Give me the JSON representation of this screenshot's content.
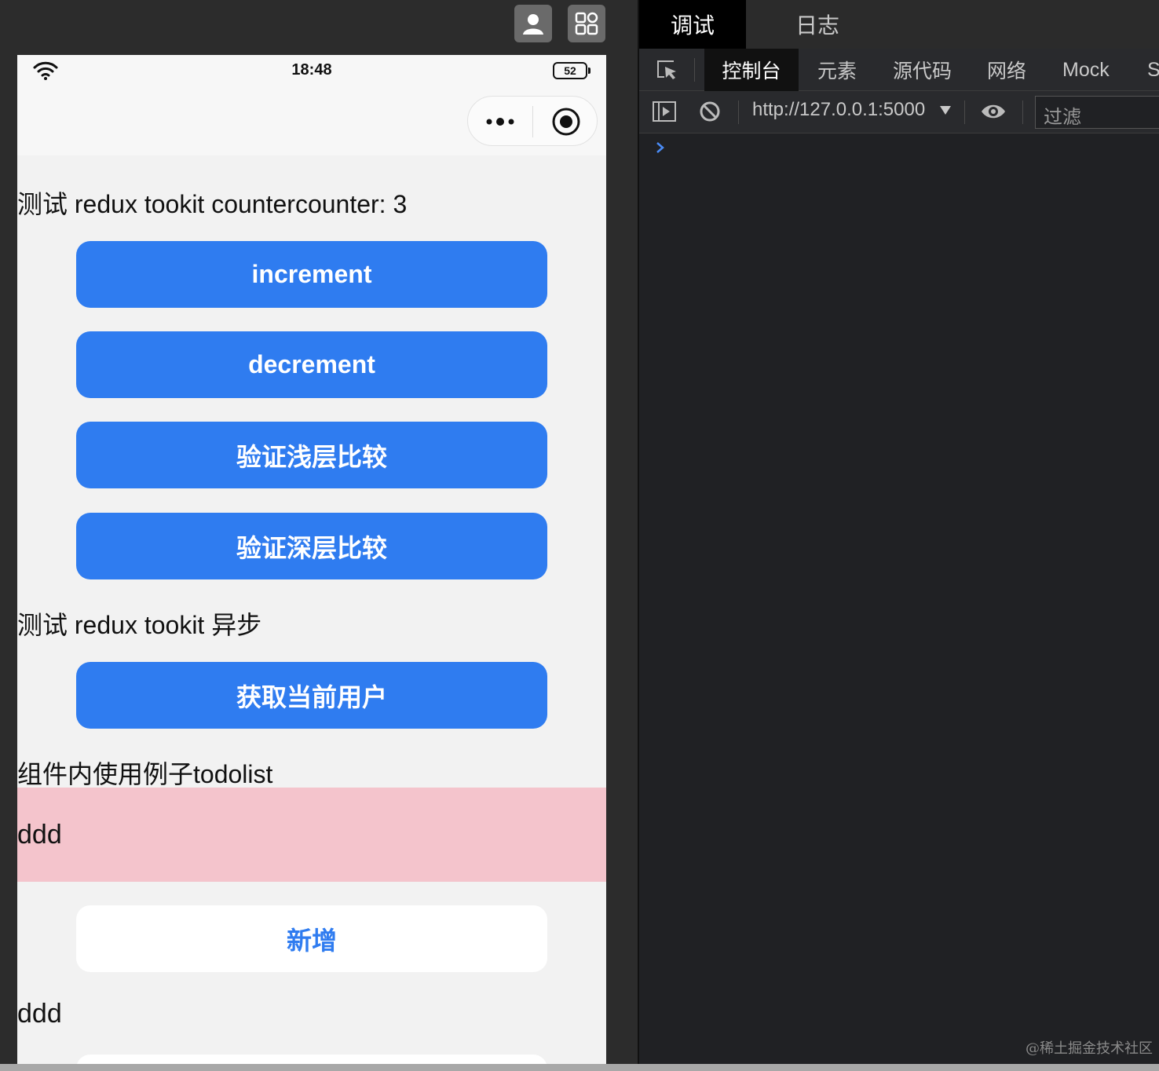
{
  "simulator": {
    "toolbar": {
      "avatar_icon": "person-icon",
      "grid_icon": "grid-icon"
    },
    "status_bar": {
      "time": "18:48",
      "battery": "52"
    },
    "capsule": {
      "more_icon": "more-dots-icon",
      "close_icon": "record-close-icon"
    }
  },
  "page": {
    "counter_text": "测试 redux tookit countercounter: 3",
    "buttons": {
      "increment": "increment",
      "decrement": "decrement",
      "shallow": "验证浅层比较",
      "deep": "验证深层比较",
      "fetch_user": "获取当前用户",
      "add": "新增"
    },
    "async_heading": "测试 redux tookit 异步",
    "todolist_heading": "组件内使用例子todolist",
    "todo_item_1": "ddd",
    "todo_item_2": "ddd"
  },
  "devtools": {
    "top_tabs": [
      "调试",
      "日志"
    ],
    "panel_tabs": [
      "控制台",
      "元素",
      "源代码",
      "网络",
      "Mock",
      "S"
    ],
    "context": "http://127.0.0.1:5000",
    "filter_placeholder": "过滤"
  },
  "watermark": "@稀土掘金技术社区",
  "colors": {
    "primary_button": "#2f7cf0",
    "todo_highlight": "#f4c4cc",
    "devtools_bg": "#202124",
    "prompt_arrow": "#4a8cf7"
  }
}
